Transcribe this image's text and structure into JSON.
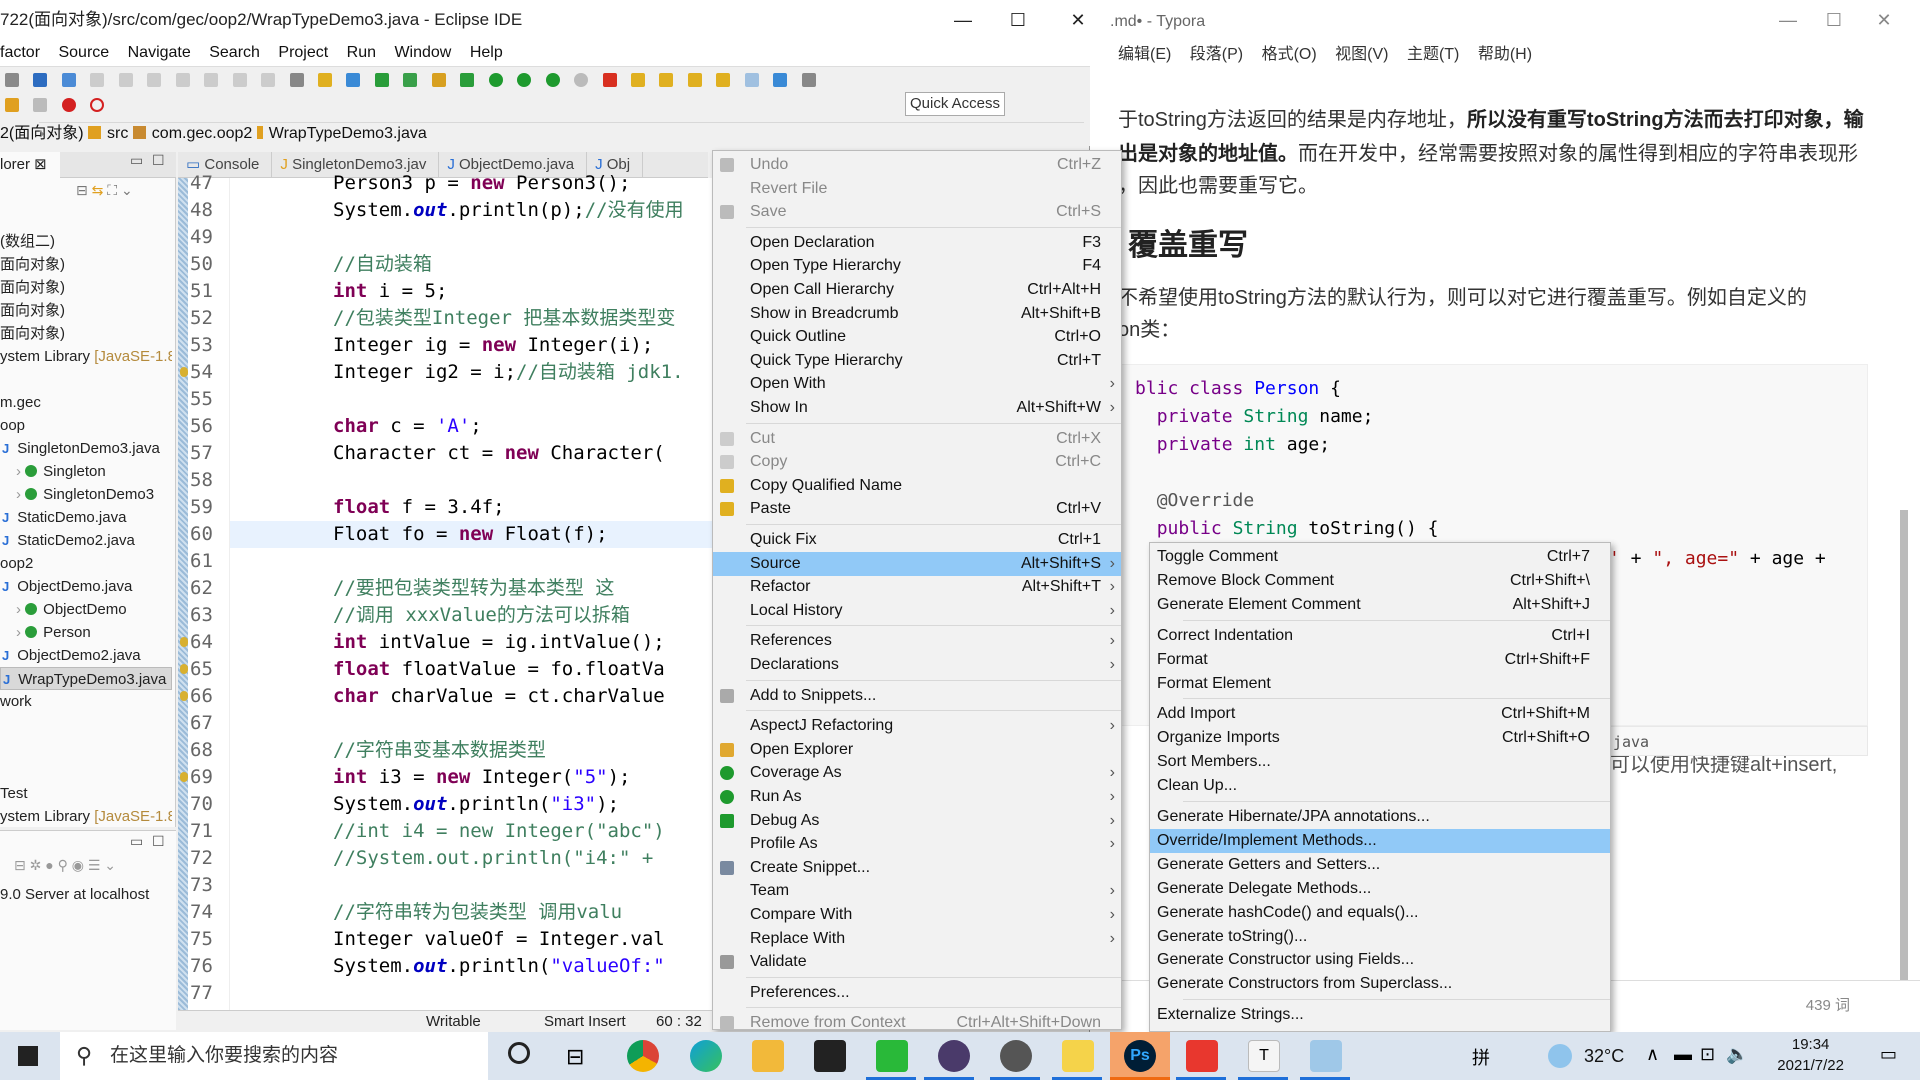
{
  "eclipse": {
    "title": "722(面向对象)/src/com/gec/oop2/WrapTypeDemo3.java - Eclipse IDE",
    "menu": [
      "factor",
      "Source",
      "Navigate",
      "Search",
      "Project",
      "Run",
      "Window",
      "Help"
    ],
    "quick_access": "Quick Access",
    "breadcrumb": [
      "2(面向对象)",
      "src",
      "com.gec.oop2",
      "WrapTypeDemo3.java"
    ],
    "package_explorer": {
      "tab_label": "lorer",
      "items": [
        {
          "label": "(数组二)"
        },
        {
          "label": "面向对象)"
        },
        {
          "label": "面向对象)"
        },
        {
          "label": "面向对象)"
        },
        {
          "label": "面向对象)"
        },
        {
          "label": "ystem Library",
          "extra": "[JavaSE-1.8]"
        },
        {
          "label": "m.gec"
        },
        {
          "label": "oop"
        },
        {
          "label": "SingletonDemo3.java",
          "icon": "java-file"
        },
        {
          "label": "Singleton",
          "icon": "class"
        },
        {
          "label": "SingletonDemo3",
          "icon": "class"
        },
        {
          "label": "StaticDemo.java",
          "icon": "java-file"
        },
        {
          "label": "StaticDemo2.java",
          "icon": "java-file"
        },
        {
          "label": "oop2"
        },
        {
          "label": "ObjectDemo.java",
          "icon": "java-file"
        },
        {
          "label": "ObjectDemo",
          "icon": "class"
        },
        {
          "label": "Person",
          "icon": "class"
        },
        {
          "label": "ObjectDemo2.java",
          "icon": "java-file"
        },
        {
          "label": "WrapTypeDemo3.java",
          "icon": "java-file",
          "selected": true
        },
        {
          "label": "work"
        },
        {
          "label": "Test"
        },
        {
          "label": "ystem Library",
          "extra": "[JavaSE-1.8]"
        }
      ],
      "server": "9.0 Server at localhost"
    },
    "editor_tabs": [
      "Console",
      "SingletonDemo3.jav",
      "ObjectDemo.java",
      "Obj"
    ],
    "code_lines": [
      {
        "n": "47",
        "t": "Person3 p = new Person3();"
      },
      {
        "n": "48",
        "t": "System.out.println(p);//没有使用"
      },
      {
        "n": "49",
        "t": ""
      },
      {
        "n": "50",
        "t": "//自动装箱"
      },
      {
        "n": "51",
        "t": "int i = 5;"
      },
      {
        "n": "52",
        "t": "//包装类型Integer 把基本数据类型变"
      },
      {
        "n": "53",
        "t": "Integer ig = new Integer(i);"
      },
      {
        "n": "54",
        "t": "Integer ig2 = i;//自动装箱 jdk1."
      },
      {
        "n": "55",
        "t": ""
      },
      {
        "n": "56",
        "t": "char c = 'A';"
      },
      {
        "n": "57",
        "t": "Character ct = new Character("
      },
      {
        "n": "58",
        "t": ""
      },
      {
        "n": "59",
        "t": "float f = 3.4f;"
      },
      {
        "n": "60",
        "t": "Float fo = new Float(f);"
      },
      {
        "n": "61",
        "t": ""
      },
      {
        "n": "62",
        "t": "//要把包装类型转为基本类型 这"
      },
      {
        "n": "63",
        "t": "//调用 xxxValue的方法可以拆箱"
      },
      {
        "n": "64",
        "t": "int intValue = ig.intValue();"
      },
      {
        "n": "65",
        "t": "float floatValue = fo.floatVa"
      },
      {
        "n": "66",
        "t": "char charValue = ct.charValue"
      },
      {
        "n": "67",
        "t": ""
      },
      {
        "n": "68",
        "t": "//字符串变基本数据类型"
      },
      {
        "n": "69",
        "t": "int i3 = new Integer(\"5\");"
      },
      {
        "n": "70",
        "t": "System.out.println(\"i3\");"
      },
      {
        "n": "71",
        "t": "//int i4 = new Integer(\"abc\")"
      },
      {
        "n": "72",
        "t": "//System.out.println(\"i4:\" +"
      },
      {
        "n": "73",
        "t": ""
      },
      {
        "n": "74",
        "t": "//字符串转为包装类型 调用valu"
      },
      {
        "n": "75",
        "t": "Integer valueOf = Integer.val"
      },
      {
        "n": "76",
        "t": "System.out.println(\"valueOf:\""
      },
      {
        "n": "77",
        "t": ""
      }
    ],
    "status": {
      "writable": "Writable",
      "insert_mode": "Smart Insert",
      "position": "60 : 32"
    }
  },
  "context_menu": {
    "items": [
      {
        "label": "Undo",
        "shortcut": "Ctrl+Z",
        "disabled": true,
        "icon": "undo-icon"
      },
      {
        "label": "Revert File",
        "disabled": true
      },
      {
        "label": "Save",
        "shortcut": "Ctrl+S",
        "disabled": true,
        "icon": "save-icon"
      },
      {
        "sep": true
      },
      {
        "label": "Open Declaration",
        "shortcut": "F3"
      },
      {
        "label": "Open Type Hierarchy",
        "shortcut": "F4"
      },
      {
        "label": "Open Call Hierarchy",
        "shortcut": "Ctrl+Alt+H"
      },
      {
        "label": "Show in Breadcrumb",
        "shortcut": "Alt+Shift+B"
      },
      {
        "label": "Quick Outline",
        "shortcut": "Ctrl+O"
      },
      {
        "label": "Quick Type Hierarchy",
        "shortcut": "Ctrl+T"
      },
      {
        "label": "Open With",
        "submenu": true
      },
      {
        "label": "Show In",
        "shortcut": "Alt+Shift+W",
        "submenu": true
      },
      {
        "sep": true
      },
      {
        "label": "Cut",
        "shortcut": "Ctrl+X",
        "disabled": true,
        "icon": "cut-icon"
      },
      {
        "label": "Copy",
        "shortcut": "Ctrl+C",
        "disabled": true,
        "icon": "copy-icon"
      },
      {
        "label": "Copy Qualified Name",
        "icon": "copy-qualified-icon"
      },
      {
        "label": "Paste",
        "shortcut": "Ctrl+V",
        "icon": "paste-icon"
      },
      {
        "sep": true
      },
      {
        "label": "Quick Fix",
        "shortcut": "Ctrl+1"
      },
      {
        "label": "Source",
        "shortcut": "Alt+Shift+S",
        "submenu": true,
        "active": true
      },
      {
        "label": "Refactor",
        "shortcut": "Alt+Shift+T",
        "submenu": true
      },
      {
        "label": "Local History",
        "submenu": true
      },
      {
        "sep": true
      },
      {
        "label": "References",
        "submenu": true
      },
      {
        "label": "Declarations",
        "submenu": true
      },
      {
        "sep": true
      },
      {
        "label": "Add to Snippets...",
        "icon": "snippet-icon"
      },
      {
        "sep": true
      },
      {
        "label": "AspectJ Refactoring",
        "submenu": true
      },
      {
        "label": "Open Explorer",
        "icon": "folder-icon"
      },
      {
        "label": "Coverage As",
        "submenu": true,
        "icon": "coverage-icon"
      },
      {
        "label": "Run As",
        "submenu": true,
        "icon": "run-icon"
      },
      {
        "label": "Debug As",
        "submenu": true,
        "icon": "debug-icon"
      },
      {
        "label": "Profile As",
        "submenu": true
      },
      {
        "label": "Create Snippet...",
        "icon": "create-snippet-icon"
      },
      {
        "label": "Team",
        "submenu": true
      },
      {
        "label": "Compare With",
        "submenu": true
      },
      {
        "label": "Replace With",
        "submenu": true
      },
      {
        "label": "Validate",
        "icon": "validate-icon"
      },
      {
        "sep": true
      },
      {
        "label": "Preferences..."
      },
      {
        "sep": true
      },
      {
        "label": "Remove from Context",
        "shortcut": "Ctrl+Alt+Shift+Down",
        "disabled": true,
        "icon": "remove-context-icon"
      }
    ]
  },
  "source_submenu": {
    "items": [
      {
        "label": "Toggle Comment",
        "shortcut": "Ctrl+7"
      },
      {
        "label": "Remove Block Comment",
        "shortcut": "Ctrl+Shift+\\"
      },
      {
        "label": "Generate Element Comment",
        "shortcut": "Alt+Shift+J"
      },
      {
        "sep": true
      },
      {
        "label": "Correct Indentation",
        "shortcut": "Ctrl+I"
      },
      {
        "label": "Format",
        "shortcut": "Ctrl+Shift+F"
      },
      {
        "label": "Format Element"
      },
      {
        "sep": true
      },
      {
        "label": "Add Import",
        "shortcut": "Ctrl+Shift+M"
      },
      {
        "label": "Organize Imports",
        "shortcut": "Ctrl+Shift+O"
      },
      {
        "label": "Sort Members..."
      },
      {
        "label": "Clean Up..."
      },
      {
        "sep": true
      },
      {
        "label": "Generate Hibernate/JPA annotations..."
      },
      {
        "label": "Override/Implement Methods...",
        "active": true
      },
      {
        "label": "Generate Getters and Setters..."
      },
      {
        "label": "Generate Delegate Methods..."
      },
      {
        "label": "Generate hashCode() and equals()..."
      },
      {
        "label": "Generate toString()..."
      },
      {
        "label": "Generate Constructor using Fields..."
      },
      {
        "label": "Generate Constructors from Superclass..."
      },
      {
        "sep": true
      },
      {
        "label": "Externalize Strings..."
      }
    ]
  },
  "typora": {
    "title": ".md• - Typora",
    "menu": [
      "编辑(E)",
      "段落(P)",
      "格式(O)",
      "视图(V)",
      "主题(T)",
      "帮助(H)"
    ],
    "para1_a": "于toString方法返回的结果是内存地址，",
    "para1_b": "所以没有重写toString方法而去打印对象，输",
    "para2_a": "出是对象的地址值。",
    "para2_b": "而在开发中，经常需要按照对象的属性得到相应的字符串表现形",
    "para3": "，因此也需要重写它。",
    "heading": "覆盖重写",
    "para4": "不希望使用toString方法的默认行为，则可以对它进行覆盖重写。例如自定义的",
    "para5": "on类：",
    "code_lang": "java",
    "after_code": "可以使用快捷键alt+insert,",
    "word_count": "439 词"
  },
  "taskbar": {
    "search_placeholder": "在这里输入你要搜索的内容",
    "weather": "32°C",
    "time": "19:34",
    "date": "2021/7/22",
    "ime": "拼"
  }
}
